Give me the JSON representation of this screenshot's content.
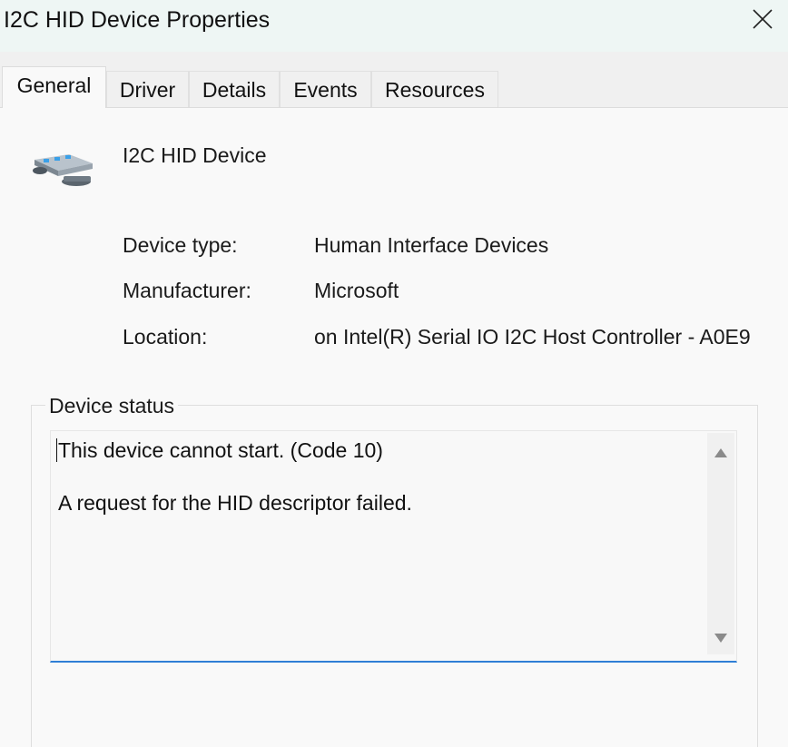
{
  "window": {
    "title": "I2C HID Device Properties"
  },
  "tabs": [
    {
      "label": "General",
      "active": true
    },
    {
      "label": "Driver",
      "active": false
    },
    {
      "label": "Details",
      "active": false
    },
    {
      "label": "Events",
      "active": false
    },
    {
      "label": "Resources",
      "active": false
    }
  ],
  "device": {
    "name": "I2C HID Device",
    "icon": "hid-device-icon"
  },
  "properties": [
    {
      "label": "Device type:",
      "value": "Human Interface Devices"
    },
    {
      "label": "Manufacturer:",
      "value": "Microsoft"
    },
    {
      "label": "Location:",
      "value": "on Intel(R) Serial IO I2C Host Controller - A0E9"
    }
  ],
  "status": {
    "legend": "Device status",
    "line1": "This device cannot start. (Code 10)",
    "line2": "A request for the HID descriptor failed."
  },
  "colors": {
    "titlebar": "#eef6f4",
    "panel": "#f9f9f9",
    "focus_underline": "#2f7fd6"
  }
}
